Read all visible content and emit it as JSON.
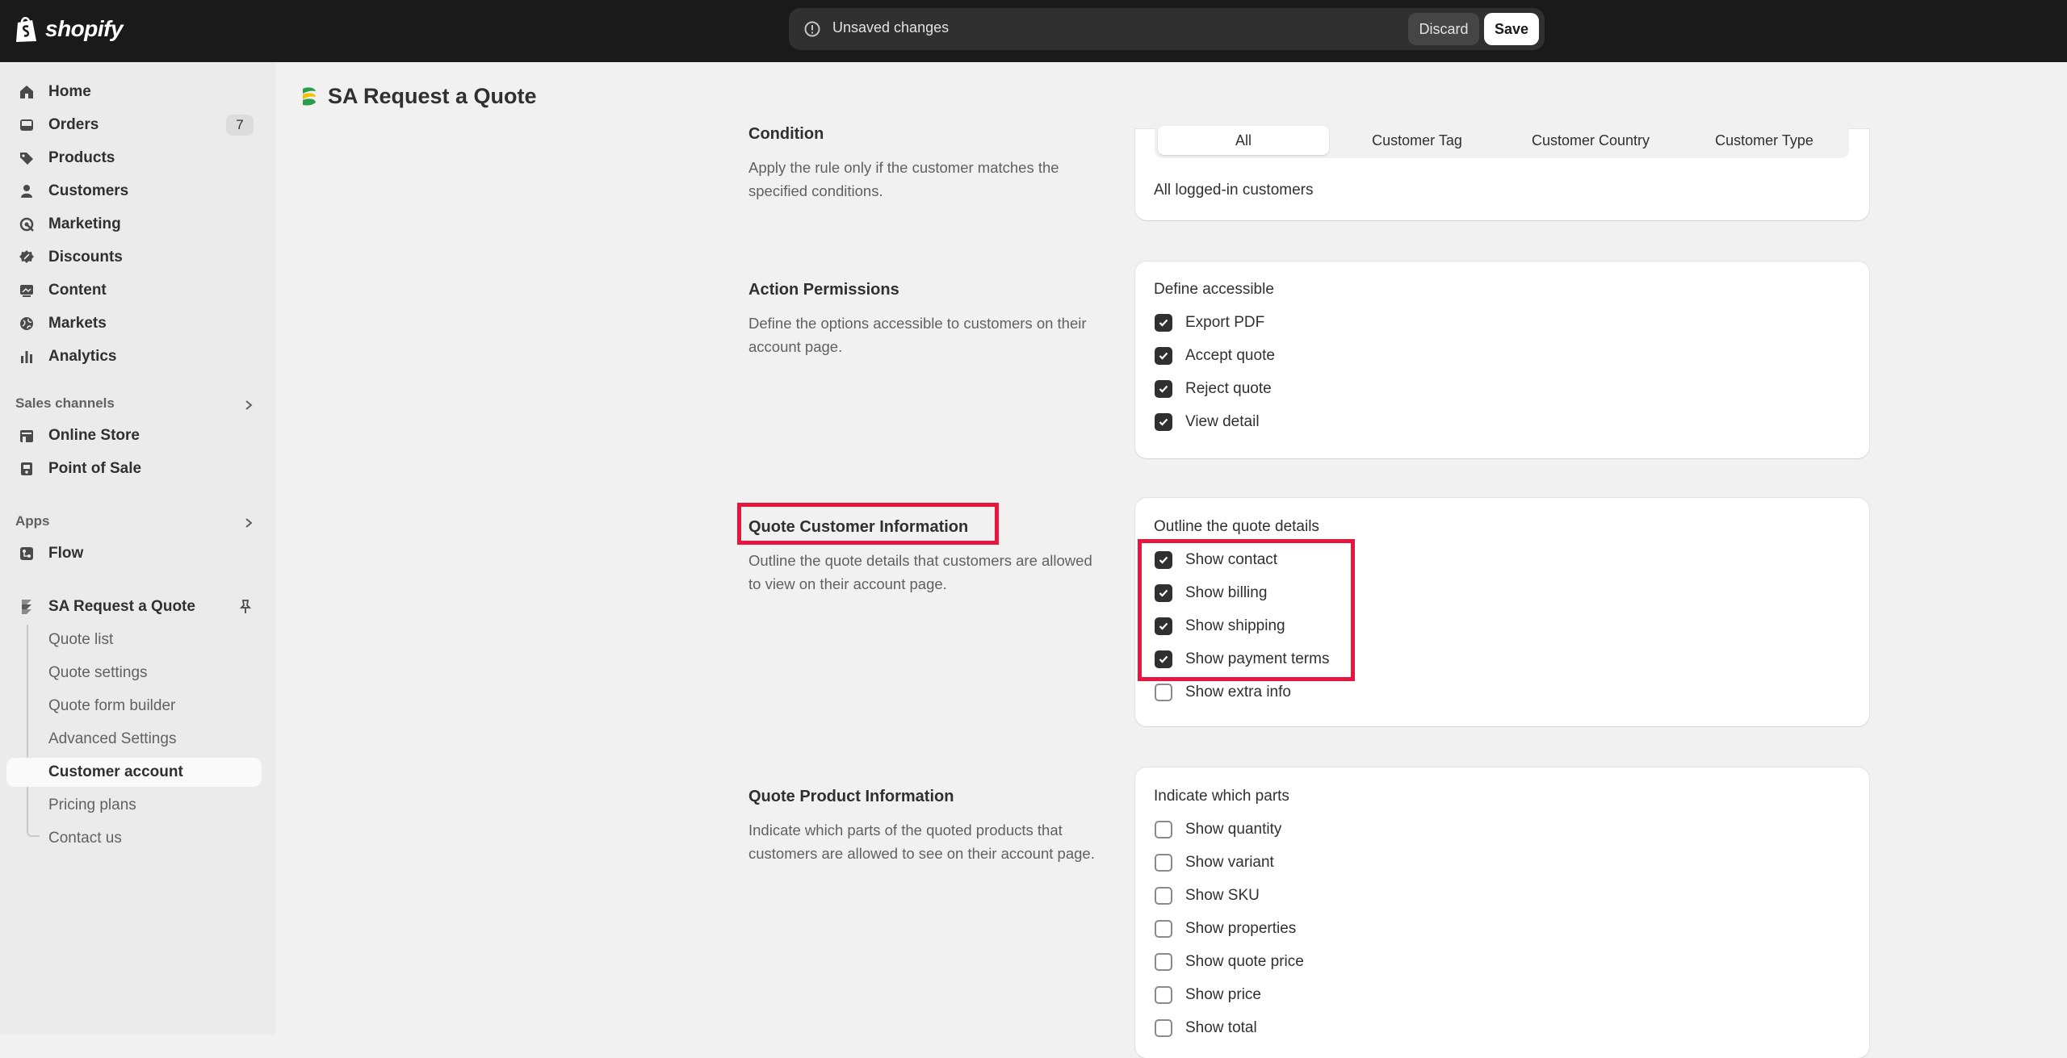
{
  "topbar": {
    "brand": "shopify",
    "unsaved_text": "Unsaved changes",
    "discard_label": "Discard",
    "save_label": "Save"
  },
  "sidebar": {
    "items": [
      {
        "label": "Home",
        "icon": "home-icon"
      },
      {
        "label": "Orders",
        "icon": "orders-icon",
        "badge": "7"
      },
      {
        "label": "Products",
        "icon": "tag-icon"
      },
      {
        "label": "Customers",
        "icon": "person-icon"
      },
      {
        "label": "Marketing",
        "icon": "target-icon"
      },
      {
        "label": "Discounts",
        "icon": "discount-icon"
      },
      {
        "label": "Content",
        "icon": "content-icon"
      },
      {
        "label": "Markets",
        "icon": "globe-icon"
      },
      {
        "label": "Analytics",
        "icon": "bar-chart-icon"
      }
    ],
    "sales_channels_title": "Sales channels",
    "sales_channels": [
      {
        "label": "Online Store",
        "icon": "store-icon"
      },
      {
        "label": "Point of Sale",
        "icon": "pos-icon"
      }
    ],
    "apps_title": "Apps",
    "apps": [
      {
        "label": "Flow",
        "icon": "flow-icon"
      }
    ],
    "app_name": "SA Request a Quote",
    "app_subitems": [
      "Quote list",
      "Quote settings",
      "Quote form builder",
      "Advanced Settings",
      "Customer account",
      "Pricing plans",
      "Contact us"
    ],
    "active_subitem": "Customer account"
  },
  "page": {
    "title": "SA Request a Quote"
  },
  "sections": {
    "condition": {
      "title": "Condition",
      "description": "Apply the rule only if the customer matches the specified conditions.",
      "tabs": [
        "All",
        "Customer Tag",
        "Customer Country",
        "Customer Type"
      ],
      "active_tab": "All",
      "summary": "All logged-in customers"
    },
    "action_permissions": {
      "title": "Action Permissions",
      "description": "Define the options accessible to customers on their account page.",
      "card_label": "Define accessible",
      "options": [
        {
          "label": "Export PDF",
          "checked": true
        },
        {
          "label": "Accept quote",
          "checked": true
        },
        {
          "label": "Reject quote",
          "checked": true
        },
        {
          "label": "View detail",
          "checked": true
        }
      ]
    },
    "quote_customer_info": {
      "title": "Quote Customer Information",
      "description": "Outline the quote details that customers are allowed to view on their account page.",
      "card_label": "Outline the quote details",
      "options": [
        {
          "label": "Show contact",
          "checked": true
        },
        {
          "label": "Show billing",
          "checked": true
        },
        {
          "label": "Show shipping",
          "checked": true
        },
        {
          "label": "Show payment terms",
          "checked": true
        },
        {
          "label": "Show extra info",
          "checked": false
        }
      ]
    },
    "quote_product_info": {
      "title": "Quote Product Information",
      "description": "Indicate which parts of the quoted products that customers are allowed to see on their account page.",
      "card_label": "Indicate which parts",
      "options": [
        {
          "label": "Show quantity",
          "checked": false
        },
        {
          "label": "Show variant",
          "checked": false
        },
        {
          "label": "Show SKU",
          "checked": false
        },
        {
          "label": "Show properties",
          "checked": false
        },
        {
          "label": "Show quote price",
          "checked": false
        },
        {
          "label": "Show price",
          "checked": false
        },
        {
          "label": "Show total",
          "checked": false
        }
      ]
    }
  },
  "colors": {
    "topbar_bg": "#1a1a1a",
    "highlight": "#e8163f",
    "checkbox_on": "#303030"
  }
}
